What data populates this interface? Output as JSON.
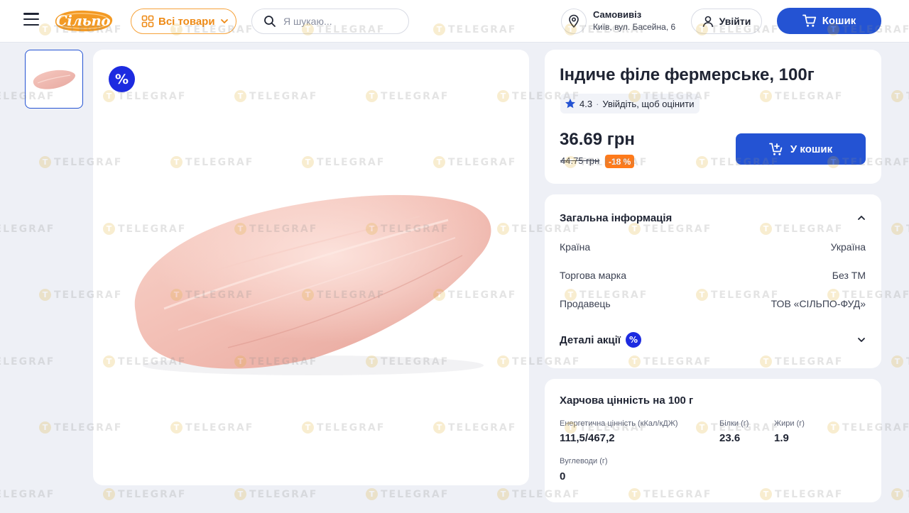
{
  "header": {
    "logo_text": "Сільпо",
    "all_goods_label": "Всі товари",
    "search_placeholder": "Я шукаю...",
    "pickup_title": "Самовивіз",
    "pickup_address": "Київ, вул. Басейна, 6",
    "login_label": "Увійти",
    "cart_label": "Кошик"
  },
  "product": {
    "title": "Індиче філе фермерське, 100г",
    "rating": "4.3",
    "rating_separator": "·",
    "rate_prompt": "Увійдіть, щоб оцінити",
    "price": "36.69 грн",
    "old_price": "44.75 грн",
    "discount": "-18 %",
    "add_to_cart_label": "У кошик",
    "promo_badge_symbol": "%"
  },
  "general_info": {
    "title": "Загальна інформація",
    "rows": [
      {
        "label": "Країна",
        "value": "Україна"
      },
      {
        "label": "Торгова марка",
        "value": "Без ТМ"
      },
      {
        "label": "Продавець",
        "value": "ТОВ «СІЛЬПО-ФУД»"
      }
    ],
    "promo_details_label": "Деталі акції",
    "promo_badge_symbol": "%"
  },
  "nutrition": {
    "title": "Харчова цінність на 100 г",
    "items": [
      {
        "label": "Енергетична цінність (кКал/кДЖ)",
        "value": "111,5/467,2"
      },
      {
        "label": "Білки (г)",
        "value": "23.6"
      },
      {
        "label": "Жири (г)",
        "value": "1.9"
      },
      {
        "label": "Вуглеводи (г)",
        "value": "0"
      }
    ]
  },
  "watermark": {
    "text": "TELEGRAF",
    "symbol": "T"
  },
  "colors": {
    "accent_blue": "#2453d3",
    "brand_orange": "#f6a23a",
    "discount_orange": "#ff7a1a",
    "promo_badge": "#1d2be0",
    "star": "#2453d3"
  },
  "icons": {
    "menu": "hamburger-icon",
    "grid": "grid-icon",
    "chevron": "chevron-down-icon",
    "search": "search-icon",
    "location": "location-pin-icon",
    "user": "user-icon",
    "cart": "cart-icon",
    "star": "star-icon"
  }
}
